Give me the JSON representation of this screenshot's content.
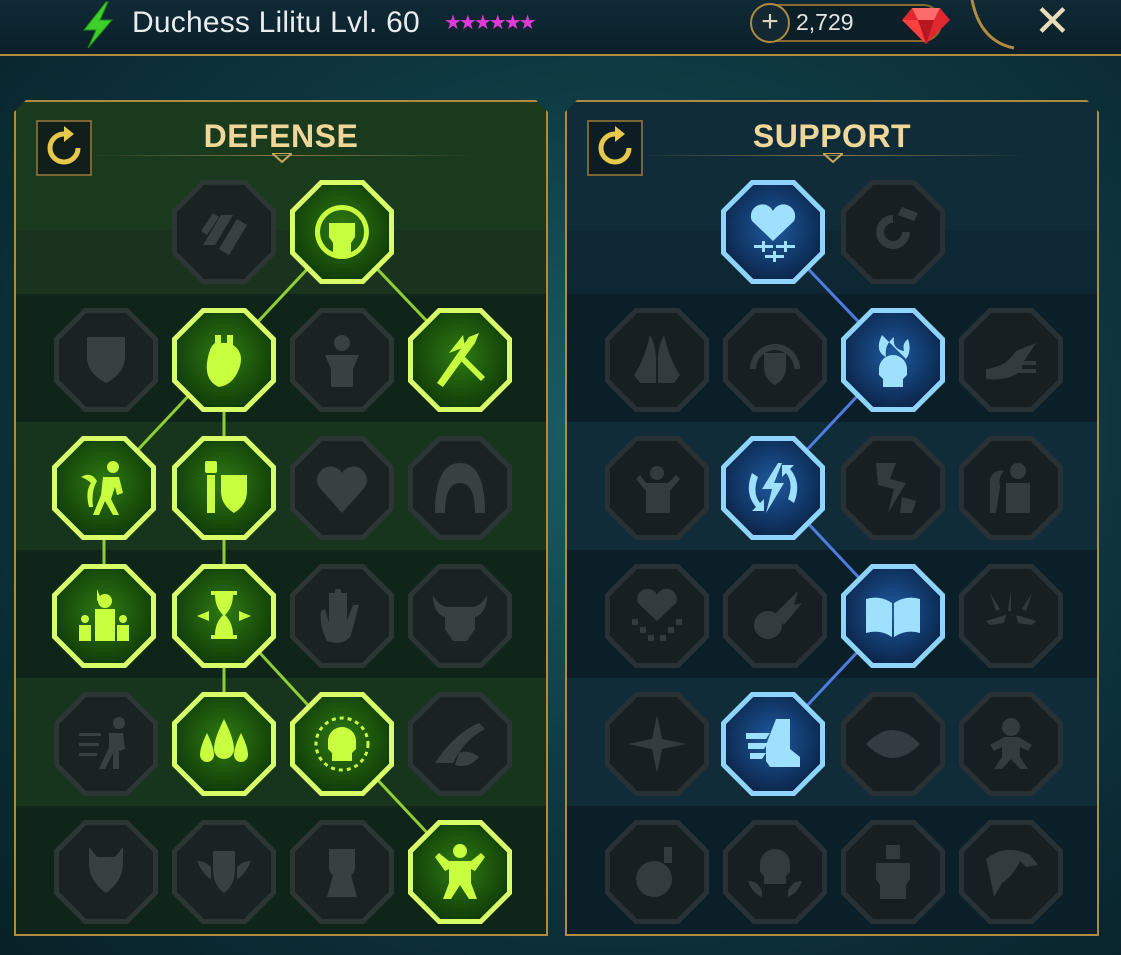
{
  "header": {
    "title": "Duchess Lilitu Lvl. 60",
    "stars": "★★★★★★",
    "gem_count": "2,729",
    "plus_label": "+",
    "close_label": "✕"
  },
  "colors": {
    "defense_accent": "#c8ff3e",
    "support_accent": "#8fd4ff",
    "gold": "#b08a40",
    "stars": "#e23ad8"
  },
  "defense": {
    "title": "DEFENSE",
    "nodes": [
      {
        "id": "d-0-1",
        "icon": "shattered-shield-icon",
        "state": "locked"
      },
      {
        "id": "d-0-2",
        "icon": "raised-fist-icon",
        "state": "active"
      },
      {
        "id": "d-1-0",
        "icon": "layered-shield-icon",
        "state": "locked"
      },
      {
        "id": "d-1-1",
        "icon": "heart-organ-icon",
        "state": "active"
      },
      {
        "id": "d-1-2",
        "icon": "warrior-icon",
        "state": "locked"
      },
      {
        "id": "d-1-3",
        "icon": "crossed-blades-icon",
        "state": "active"
      },
      {
        "id": "d-2-0",
        "icon": "running-figure-icon",
        "state": "active"
      },
      {
        "id": "d-2-1",
        "icon": "knight-shield-icon",
        "state": "active"
      },
      {
        "id": "d-2-2",
        "icon": "skull-heart-icon",
        "state": "locked"
      },
      {
        "id": "d-2-3",
        "icon": "hooded-face-icon",
        "state": "locked"
      },
      {
        "id": "d-3-0",
        "icon": "rallying-crowd-icon",
        "state": "active"
      },
      {
        "id": "d-3-1",
        "icon": "hourglass-skull-icon",
        "state": "active"
      },
      {
        "id": "d-3-2",
        "icon": "bleeding-hand-icon",
        "state": "locked"
      },
      {
        "id": "d-3-3",
        "icon": "bull-head-icon",
        "state": "locked"
      },
      {
        "id": "d-4-0",
        "icon": "dashing-figure-icon",
        "state": "locked"
      },
      {
        "id": "d-4-1",
        "icon": "blood-drops-icon",
        "state": "active"
      },
      {
        "id": "d-4-2",
        "icon": "radiant-skull-icon",
        "state": "active"
      },
      {
        "id": "d-4-3",
        "icon": "grasping-hand-icon",
        "state": "locked"
      },
      {
        "id": "d-5-0",
        "icon": "demon-icon",
        "state": "locked"
      },
      {
        "id": "d-5-1",
        "icon": "winged-shield-icon",
        "state": "locked"
      },
      {
        "id": "d-5-2",
        "icon": "bearded-warrior-icon",
        "state": "locked"
      },
      {
        "id": "d-5-3",
        "icon": "flexing-figure-icon",
        "state": "active"
      }
    ]
  },
  "support": {
    "title": "SUPPORT",
    "nodes": [
      {
        "id": "s-0-1",
        "icon": "healing-heart-icon",
        "state": "active"
      },
      {
        "id": "s-0-2",
        "icon": "swirling-orb-icon",
        "state": "locked"
      },
      {
        "id": "s-1-0",
        "icon": "praying-hands-icon",
        "state": "locked"
      },
      {
        "id": "s-1-1",
        "icon": "arched-shield-icon",
        "state": "locked"
      },
      {
        "id": "s-1-2",
        "icon": "flaming-skull-icon",
        "state": "active"
      },
      {
        "id": "s-1-3",
        "icon": "swift-strike-icon",
        "state": "locked"
      },
      {
        "id": "s-2-0",
        "icon": "blessing-figure-icon",
        "state": "locked"
      },
      {
        "id": "s-2-1",
        "icon": "lightning-cycle-icon",
        "state": "active"
      },
      {
        "id": "s-2-2",
        "icon": "cracked-rock-icon",
        "state": "locked"
      },
      {
        "id": "s-2-3",
        "icon": "silhouettes-icon",
        "state": "locked"
      },
      {
        "id": "s-3-0",
        "icon": "chained-heart-icon",
        "state": "locked"
      },
      {
        "id": "s-3-1",
        "icon": "fireball-icon",
        "state": "locked"
      },
      {
        "id": "s-3-2",
        "icon": "open-book-icon",
        "state": "active"
      },
      {
        "id": "s-3-3",
        "icon": "angry-eyes-icon",
        "state": "locked"
      },
      {
        "id": "s-4-0",
        "icon": "compass-star-icon",
        "state": "locked"
      },
      {
        "id": "s-4-1",
        "icon": "winged-boot-icon",
        "state": "active"
      },
      {
        "id": "s-4-2",
        "icon": "eye-icon",
        "state": "locked"
      },
      {
        "id": "s-4-3",
        "icon": "voodoo-doll-icon",
        "state": "locked"
      },
      {
        "id": "s-5-0",
        "icon": "potion-flask-icon",
        "state": "locked"
      },
      {
        "id": "s-5-1",
        "icon": "horned-skull-icon",
        "state": "locked"
      },
      {
        "id": "s-5-2",
        "icon": "clenched-fist-icon",
        "state": "locked"
      },
      {
        "id": "s-5-3",
        "icon": "eagle-head-icon",
        "state": "locked"
      }
    ]
  }
}
